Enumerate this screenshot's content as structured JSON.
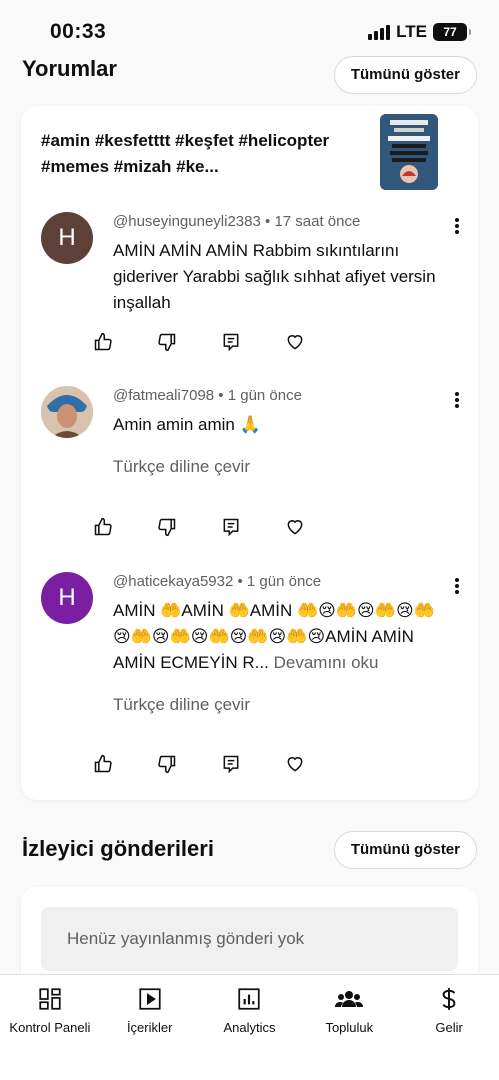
{
  "status": {
    "time": "00:33",
    "network": "LTE",
    "battery": "77"
  },
  "comments_section": {
    "title": "Yorumlar",
    "show_all": "Tümünü göster",
    "video_title": "#amin #kesfetttt #keşfet #helicopter #memes #mizah #ke...",
    "comments": [
      {
        "author": "@huseyinguneyli2383",
        "time": "17 saat önce",
        "avatar_letter": "H",
        "avatar_color": "#5d4037",
        "text": "AMİN AMİN AMİN Rabbim sıkıntılarını gideriver Yarabbi sağlık sıhhat afiyet versin inşallah"
      },
      {
        "author": "@fatmeali7098",
        "time": "1 gün önce",
        "text": "Amin amin amin 🙏",
        "translate": "Türkçe diline çevir"
      },
      {
        "author": "@haticekaya5932",
        "time": "1 gün önce",
        "avatar_letter": "H",
        "avatar_color": "#7b1fa2",
        "text": "AMİN 🤲AMİN 🤲AMİN 🤲😢🤲😢🤲😢🤲😢🤲😢🤲😢🤲😢🤲😢🤲😢AMİN AMİN AMİN ECMEYİN R...",
        "more": "Devamını oku",
        "translate": "Türkçe diline çevir"
      }
    ]
  },
  "viewer_posts": {
    "title": "İzleyici gönderileri",
    "show_all": "Tümünü göster",
    "empty_text": "Henüz yayınlanmış gönderi yok"
  },
  "nav": {
    "items": [
      {
        "label": "Kontrol Paneli",
        "icon": "dashboard-icon"
      },
      {
        "label": "İçerikler",
        "icon": "content-icon"
      },
      {
        "label": "Analytics",
        "icon": "analytics-icon"
      },
      {
        "label": "Topluluk",
        "icon": "community-icon"
      },
      {
        "label": "Gelir",
        "icon": "earn-icon"
      }
    ]
  }
}
